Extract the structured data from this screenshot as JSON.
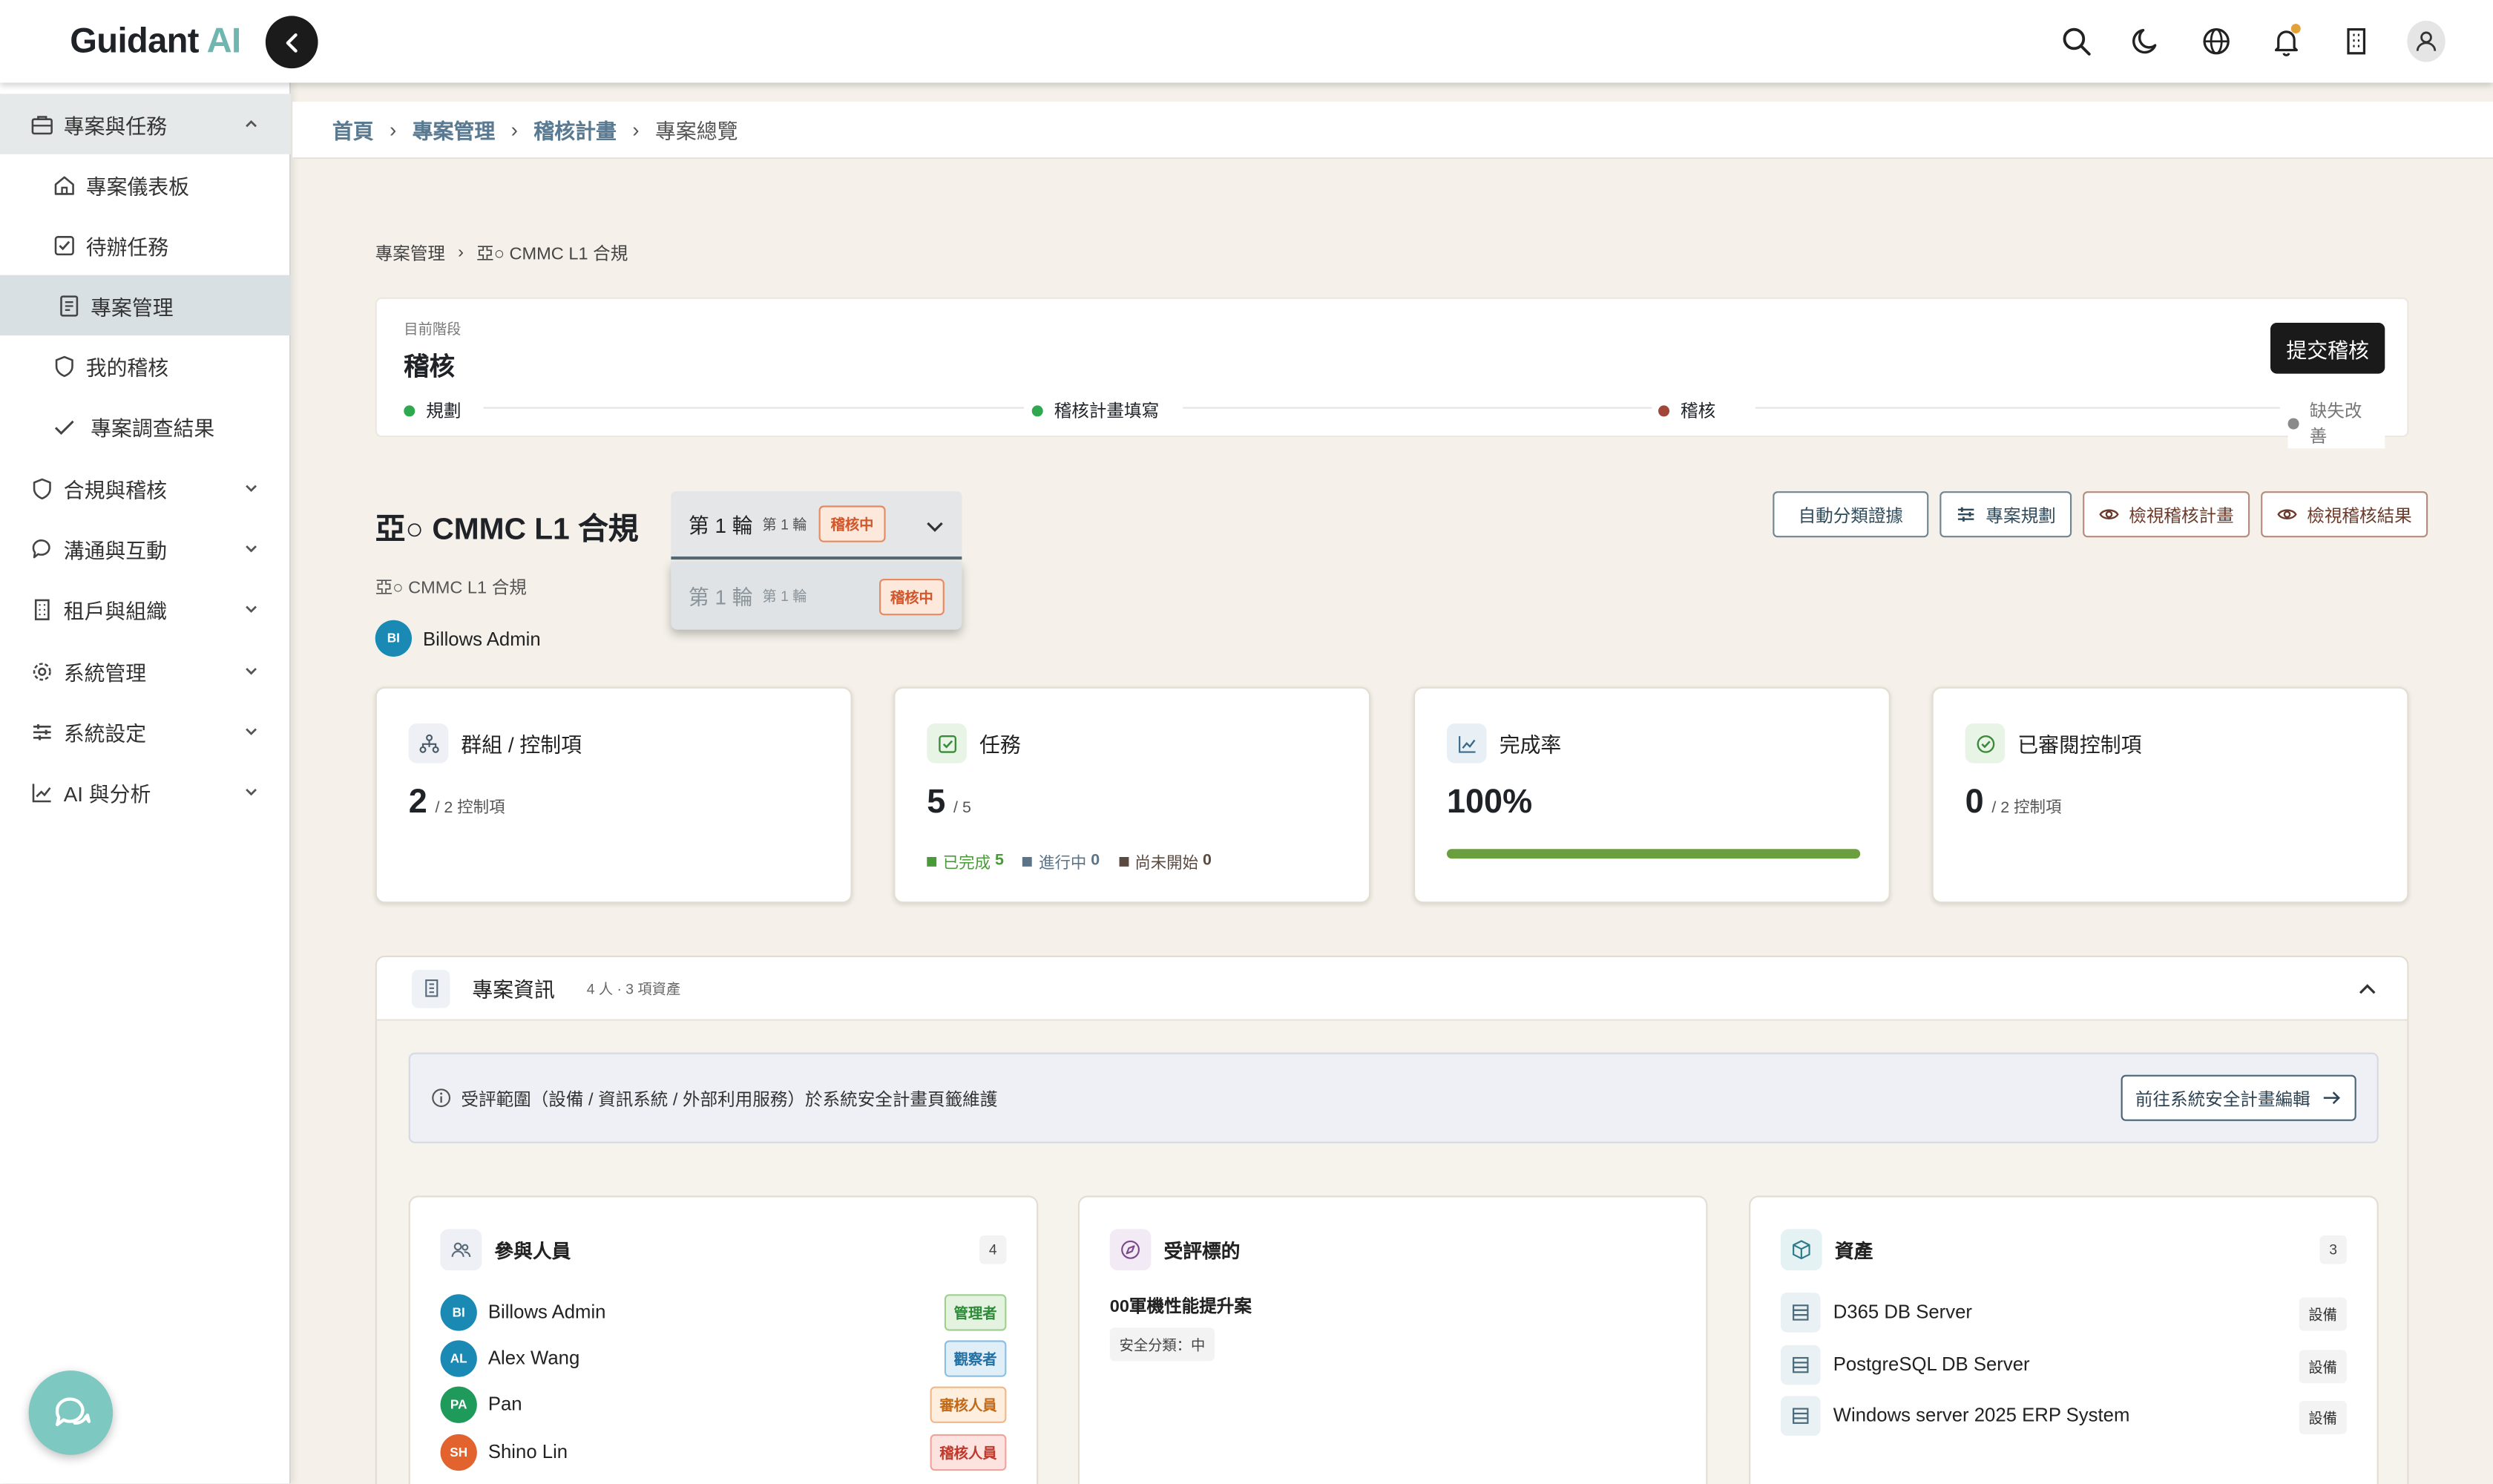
{
  "brand": {
    "name": "Guidant",
    "suffix": "AI"
  },
  "topbar": {
    "icons": [
      "search-icon",
      "moon-icon",
      "globe-icon",
      "bell-icon",
      "building-icon",
      "user-icon"
    ]
  },
  "sidebar": {
    "groups": [
      {
        "label": "專案與任務",
        "icon": "briefcase-icon",
        "expanded": true
      },
      {
        "label": "合規與稽核",
        "icon": "shield-icon"
      },
      {
        "label": "溝通與互動",
        "icon": "chat-icon"
      },
      {
        "label": "租戶與組織",
        "icon": "building-icon"
      },
      {
        "label": "系統管理",
        "icon": "gear-icon"
      },
      {
        "label": "系統設定",
        "icon": "sliders-icon"
      },
      {
        "label": "AI 與分析",
        "icon": "chart-icon"
      }
    ],
    "sub_items": [
      {
        "label": "專案儀表板",
        "icon": "home-icon"
      },
      {
        "label": "待辦任務",
        "icon": "checkbox-icon"
      },
      {
        "label": "專案管理",
        "icon": "document-icon",
        "active": true
      },
      {
        "label": "我的稽核",
        "icon": "shield-icon"
      },
      {
        "label": "專案調查結果",
        "icon": "check-icon"
      }
    ]
  },
  "breadcrumb": [
    "首頁",
    "專案管理",
    "稽核計畫",
    "專案總覽"
  ],
  "sub_breadcrumb": [
    "專案管理",
    "亞○ CMMC L1 合規"
  ],
  "stage": {
    "label": "目前階段",
    "value": "稽核",
    "submit_label": "提交稽核",
    "steps": [
      {
        "label": "規劃",
        "color": "#2fa84f"
      },
      {
        "label": "稽核計畫填寫",
        "color": "#2fa84f"
      },
      {
        "label": "稽核",
        "color": "#a0473a"
      },
      {
        "label": "缺失改善",
        "color": "#8a8a8a"
      }
    ]
  },
  "project": {
    "title": "亞○ CMMC L1 合規",
    "subtitle": "亞○ CMMC L1 合規",
    "owner": {
      "initials": "BI",
      "name": "Billows Admin"
    },
    "round": {
      "main": "第 1 輪",
      "sub": "第 1 輪",
      "status": "稽核中"
    },
    "dropdown_option": {
      "main": "第 1 輪",
      "sub": "第 1 輪",
      "status": "稽核中"
    },
    "actions": [
      {
        "label": "自動分類證據",
        "icon": ""
      },
      {
        "label": "專案規劃",
        "icon": "sliders-icon"
      },
      {
        "label": "檢視稽核計畫",
        "icon": "eye-icon"
      },
      {
        "label": "檢視稽核結果",
        "icon": "eye-icon"
      }
    ]
  },
  "stats": [
    {
      "title": "群組 / 控制項",
      "value": "2",
      "unit": "/ 2 控制項",
      "icon": "network-icon"
    },
    {
      "title": "任務",
      "value": "5",
      "unit": "/ 5",
      "icon": "checkbox-icon",
      "legend": [
        {
          "label": "已完成",
          "value": "5",
          "color": "#4a9a3a"
        },
        {
          "label": "進行中",
          "value": "0",
          "color": "#5b7488"
        },
        {
          "label": "尚未開始",
          "value": "0",
          "color": "#5a4a40"
        }
      ]
    },
    {
      "title": "完成率",
      "value": "100%",
      "progress": 1.0,
      "icon": "trend-icon"
    },
    {
      "title": "已審閱控制項",
      "value": "0",
      "unit": "/ 2 控制項",
      "icon": "check-circle-icon"
    }
  ],
  "info": {
    "title": "專案資訊",
    "meta": "4 人 · 3 項資產",
    "notice": "受評範圍（設備 / 資訊系統 / 外部利用服務）於系統安全計畫頁籤維護",
    "notice_button": "前往系統安全計畫編輯",
    "participants": {
      "title": "參與人員",
      "count": "4",
      "people": [
        {
          "initials": "BI",
          "name": "Billows Admin",
          "role": "管理者",
          "color": "#1a89b3",
          "role_fg": "#2f8a3a",
          "role_bg": "#e3f3df",
          "role_border": "#9fd08f"
        },
        {
          "initials": "AL",
          "name": "Alex Wang",
          "role": "觀察者",
          "color": "#1a89b3",
          "role_fg": "#2370a3",
          "role_bg": "#e0eef8",
          "role_border": "#8cbfe0"
        },
        {
          "initials": "PA",
          "name": "Pan",
          "role": "審核人員",
          "color": "#1e9a5a",
          "role_fg": "#c06a1a",
          "role_bg": "#fdeedd",
          "role_border": "#f0b88a"
        },
        {
          "initials": "SH",
          "name": "Shino Lin",
          "role": "稽核人員",
          "color": "#e2632e",
          "role_fg": "#c0392b",
          "role_bg": "#fde3e0",
          "role_border": "#f0a39a"
        }
      ]
    },
    "target": {
      "title": "受評標的",
      "name": "00軍機性能提升案",
      "classification": "安全分類：中"
    },
    "assets": {
      "title": "資產",
      "count": "3",
      "items": [
        {
          "name": "D365 DB Server",
          "type": "設備"
        },
        {
          "name": "PostgreSQL DB Server",
          "type": "設備"
        },
        {
          "name": "Windows server 2025 ERP System",
          "type": "設備"
        }
      ]
    }
  }
}
